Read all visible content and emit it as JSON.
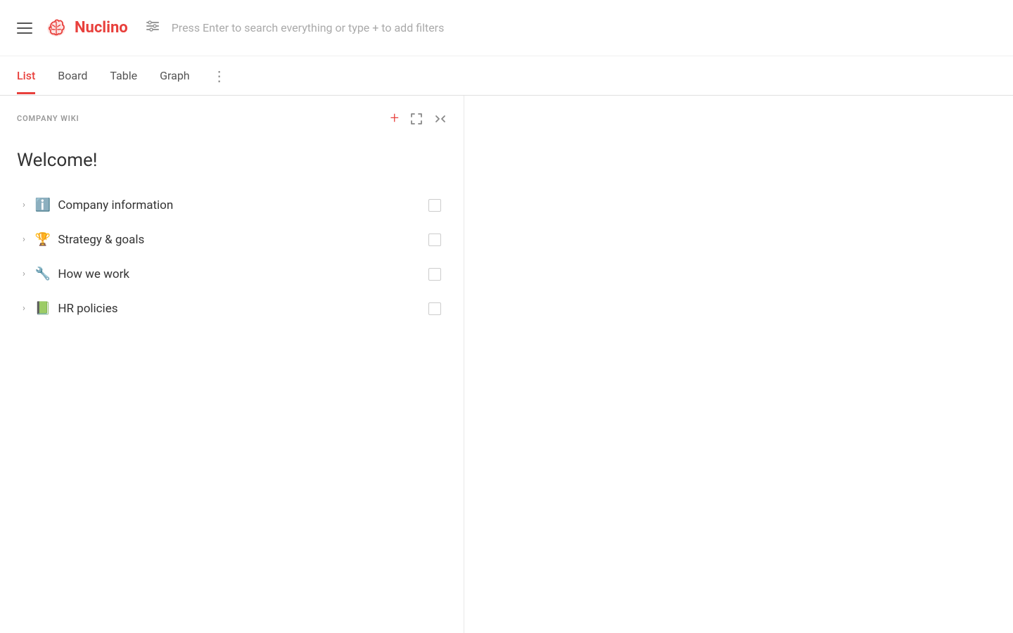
{
  "header": {
    "logo_text": "Nuclino",
    "search_placeholder": "Press Enter to search everything or type + to add filters"
  },
  "tabs": {
    "items": [
      {
        "id": "list",
        "label": "List",
        "active": true
      },
      {
        "id": "board",
        "label": "Board",
        "active": false
      },
      {
        "id": "table",
        "label": "Table",
        "active": false
      },
      {
        "id": "graph",
        "label": "Graph",
        "active": false
      }
    ],
    "more_label": "⋮"
  },
  "sidebar": {
    "title": "COMPANY WIKI",
    "welcome": "Welcome!",
    "list_items": [
      {
        "id": "company-info",
        "emoji": "ℹ️",
        "label": "Company information"
      },
      {
        "id": "strategy-goals",
        "emoji": "🏆",
        "label": "Strategy & goals"
      },
      {
        "id": "how-we-work",
        "emoji": "🔧",
        "label": "How we work"
      },
      {
        "id": "hr-policies",
        "emoji": "📗",
        "label": "HR policies"
      }
    ]
  },
  "colors": {
    "accent": "#e8403c",
    "text_primary": "#333333",
    "text_secondary": "#999999",
    "border": "#e0e0e0"
  }
}
